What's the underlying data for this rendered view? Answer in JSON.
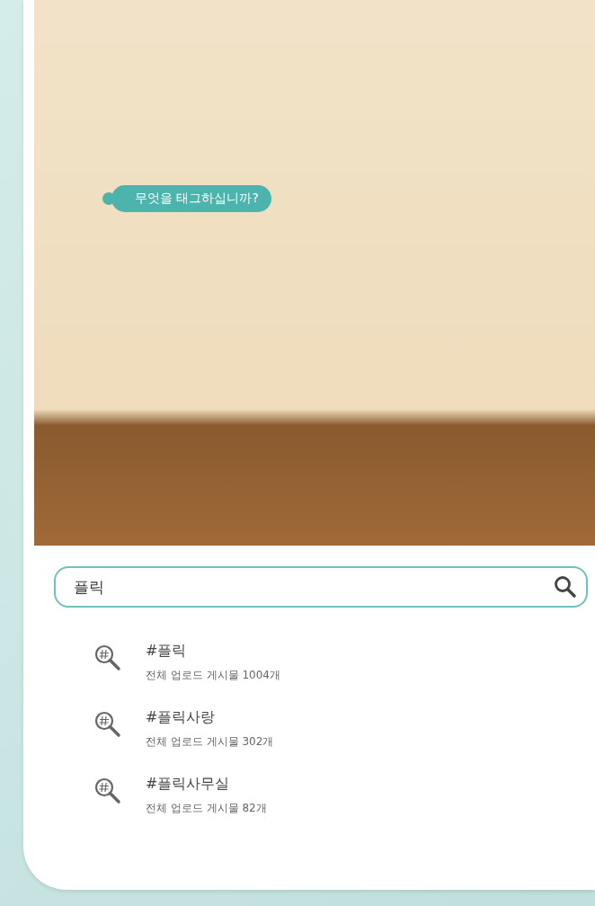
{
  "photo": {
    "tag_prompt": "무엇을 태그하십니까?"
  },
  "search": {
    "value": "플릭"
  },
  "results": [
    {
      "tag": "#플릭",
      "count": "전체 업로드 게시물 1004개"
    },
    {
      "tag": "#플릭사랑",
      "count": "전체 업로드 게시물 302개"
    },
    {
      "tag": "#플릭사무실",
      "count": "전체 업로드 게시물 82개"
    }
  ]
}
